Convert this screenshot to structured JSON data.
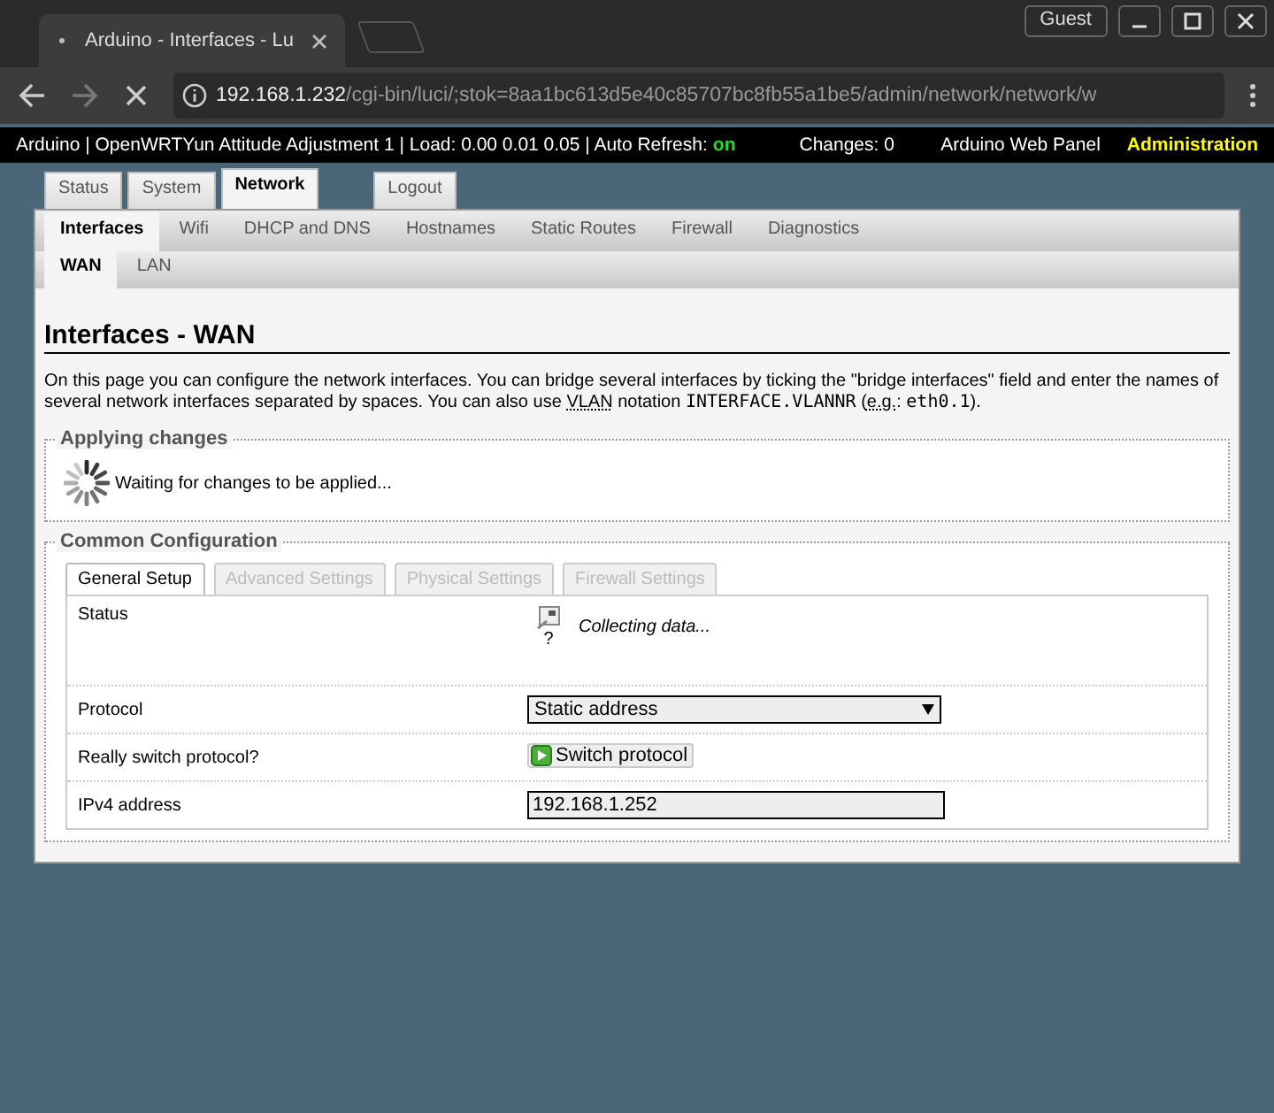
{
  "browser": {
    "tab_title": "Arduino - Interfaces - Lu",
    "profile": "Guest",
    "url_host": "192.168.1.232",
    "url_path": "/cgi-bin/luci/;stok=8aa1bc613d5e40c85707bc8fb55a1be5/admin/network/network/w"
  },
  "header": {
    "info": "Arduino | OpenWRTYun Attitude Adjustment 1 | Load: 0.00 0.01 0.05 | Auto Refresh:",
    "auto_refresh": "on",
    "changes": "Changes: 0",
    "panel": "Arduino Web Panel",
    "mode": "Administration"
  },
  "menu": [
    {
      "label": "Status",
      "selected": false
    },
    {
      "label": "System",
      "selected": false
    },
    {
      "label": "Network",
      "selected": true
    },
    {
      "label": "Logout",
      "selected": false
    }
  ],
  "submenu": [
    {
      "label": "Interfaces",
      "selected": true
    },
    {
      "label": "Wifi",
      "selected": false
    },
    {
      "label": "DHCP and DNS",
      "selected": false
    },
    {
      "label": "Hostnames",
      "selected": false
    },
    {
      "label": "Static Routes",
      "selected": false
    },
    {
      "label": "Firewall",
      "selected": false
    },
    {
      "label": "Diagnostics",
      "selected": false
    }
  ],
  "subtabs": [
    {
      "label": "WAN",
      "selected": true
    },
    {
      "label": "LAN",
      "selected": false
    }
  ],
  "page": {
    "title": "Interfaces - WAN",
    "description": [
      {
        "kind": "text",
        "text": "On this page you can configure the network interfaces. You can bridge several interfaces by ticking the \"bridge interfaces\" field and enter the names of several network interfaces separated by spaces. You can also use "
      },
      {
        "kind": "abbr",
        "text": "VLAN"
      },
      {
        "kind": "text",
        "text": " notation "
      },
      {
        "kind": "code",
        "text": "INTERFACE.VLANNR"
      },
      {
        "kind": "text",
        "text": " ("
      },
      {
        "kind": "abbr",
        "text": "e.g."
      },
      {
        "kind": "text",
        "text": ": "
      },
      {
        "kind": "code",
        "text": "eth0.1"
      },
      {
        "kind": "text",
        "text": ")."
      }
    ]
  },
  "applying": {
    "legend": "Applying changes",
    "message": "Waiting for changes to be applied..."
  },
  "config": {
    "legend": "Common Configuration",
    "tabs": [
      {
        "label": "General Setup",
        "selected": true
      },
      {
        "label": "Advanced Settings",
        "selected": false
      },
      {
        "label": "Physical Settings",
        "selected": false
      },
      {
        "label": "Firewall Settings",
        "selected": false
      }
    ],
    "rows": [
      {
        "kind": "status",
        "label": "Status",
        "icon_text": "?",
        "value": "Collecting data..."
      },
      {
        "kind": "select",
        "label": "Protocol",
        "value": "Static address"
      },
      {
        "kind": "button",
        "label": "Really switch protocol?",
        "value": "Switch protocol"
      },
      {
        "kind": "input",
        "label": "IPv4 address",
        "value": "192.168.1.252"
      }
    ]
  }
}
